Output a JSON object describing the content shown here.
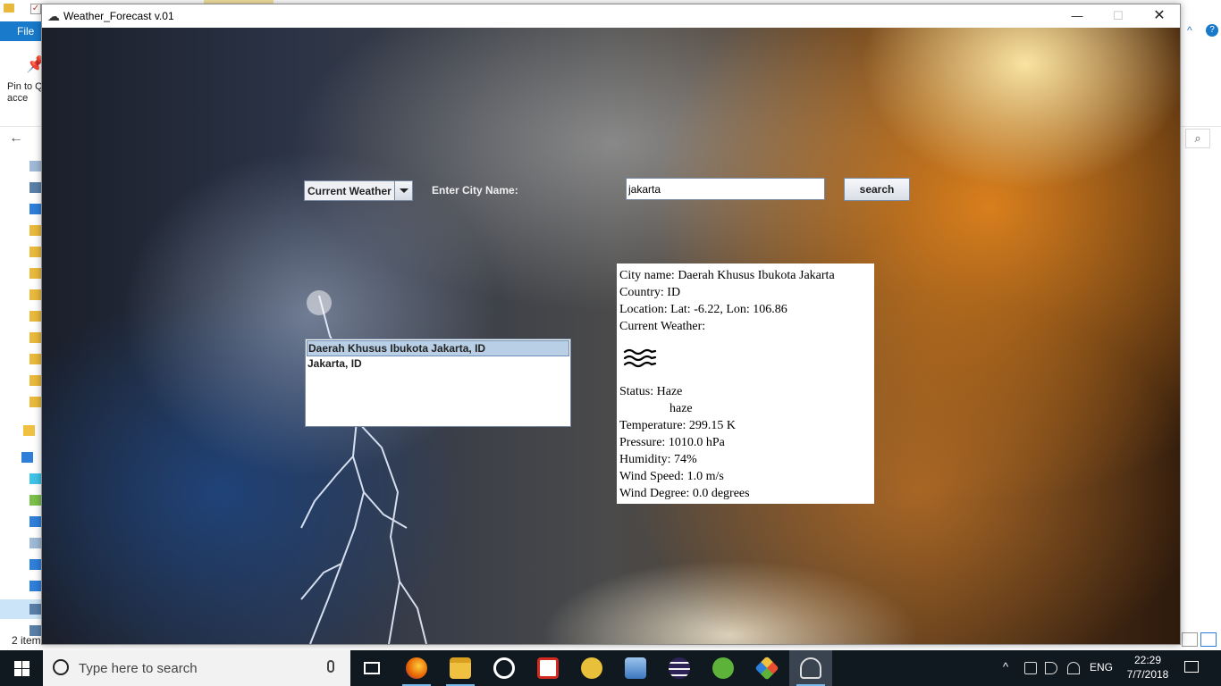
{
  "background_window": {
    "file_tab": "File",
    "pin_label": "Pin to Q\nacce",
    "status_text": "2 item"
  },
  "app": {
    "title": "Weather_Forecast v.01",
    "controls": {
      "minimize": "—",
      "maximize": "☐",
      "close": "✕"
    }
  },
  "form": {
    "mode_selected": "Current Weather",
    "city_label": "Enter City Name:",
    "city_value": "jakarta",
    "search_label": "search"
  },
  "city_results": [
    {
      "label": "Daerah Khusus Ibukota Jakarta, ID",
      "selected": true
    },
    {
      "label": "Jakarta, ID",
      "selected": false
    }
  ],
  "weather": {
    "city_name": "City name: Daerah Khusus Ibukota Jakarta",
    "country": "Country: ID",
    "location": "Location: Lat: -6.22, Lon: 106.86",
    "current_heading": "Current Weather:",
    "icon": "haze-icon",
    "status": "Status: Haze",
    "description": "haze",
    "temperature": "Temperature: 299.15 K",
    "pressure": "Pressure: 1010.0 hPa",
    "humidity": "Humidity: 74%",
    "wind_speed": "Wind Speed: 1.0 m/s",
    "wind_degree": "Wind Degree: 0.0 degrees"
  },
  "taskbar": {
    "search_placeholder": "Type here to search",
    "apps": [
      {
        "name": "task-view",
        "color": "#ffffff"
      },
      {
        "name": "firefox",
        "color": "#e66000"
      },
      {
        "name": "file-explorer",
        "color": "#f0c040"
      },
      {
        "name": "media-player",
        "color": "#ffffff"
      },
      {
        "name": "acrobat",
        "color": "#d12a1e"
      },
      {
        "name": "cat-app",
        "color": "#e8c03a"
      },
      {
        "name": "network-app",
        "color": "#6aa0d8"
      },
      {
        "name": "eclipse",
        "color": "#2c2255"
      },
      {
        "name": "utorrent",
        "color": "#5db33a"
      },
      {
        "name": "git-app",
        "color": "#e94e31"
      },
      {
        "name": "weather-app",
        "color": "#cccccc"
      }
    ],
    "language": "ENG",
    "time": "22:29",
    "date": "7/7/2018"
  }
}
